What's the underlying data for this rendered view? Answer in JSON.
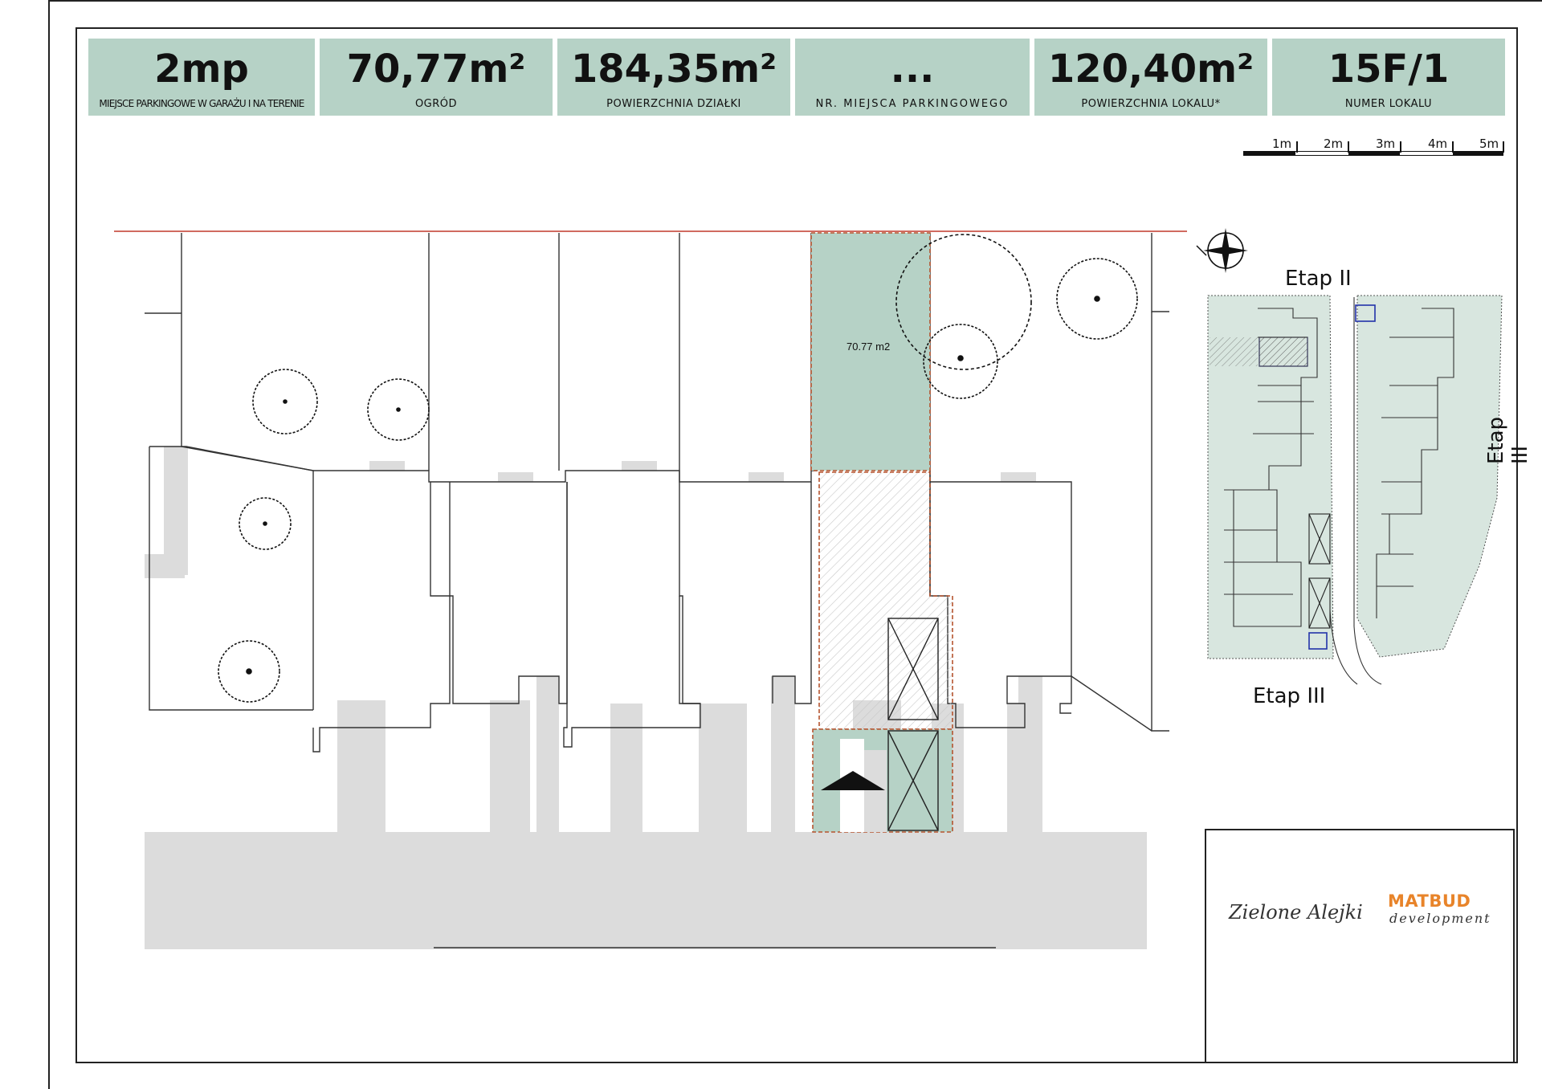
{
  "header": {
    "cards": [
      {
        "value": "2mp",
        "label": "MIEJSCE PARKINGOWE W GARAŻU I NA TERENIE"
      },
      {
        "value": "70,77m²",
        "label": "OGRÓD"
      },
      {
        "value": "184,35m²",
        "label": "POWIERZCHNIA DZIAŁKI"
      },
      {
        "value": "...",
        "label": "NR. MIEJSCA PARKINGOWEGO"
      },
      {
        "value": "120,40m²",
        "label": "POWIERZCHNIA LOKALU*"
      },
      {
        "value": "15F/1",
        "label": "NUMER LOKALU"
      }
    ]
  },
  "scale": {
    "labels": [
      "1m",
      "2m",
      "3m",
      "4m",
      "5m"
    ]
  },
  "plan": {
    "garden_area_label": "70.77 m2"
  },
  "site_map": {
    "etap_top": "Etap II",
    "etap_right": "Etap III",
    "etap_bottom": "Etap III"
  },
  "logos": {
    "project_name": "Zielone Alejki",
    "developer_name": "MATBUD",
    "developer_sub": "development"
  },
  "colors": {
    "header_bg": "#b6d2c6",
    "garden": "#b6d2c6",
    "road": "#dcdcdc",
    "boundary": "#c0392b",
    "brand_orange": "#e8842a"
  }
}
